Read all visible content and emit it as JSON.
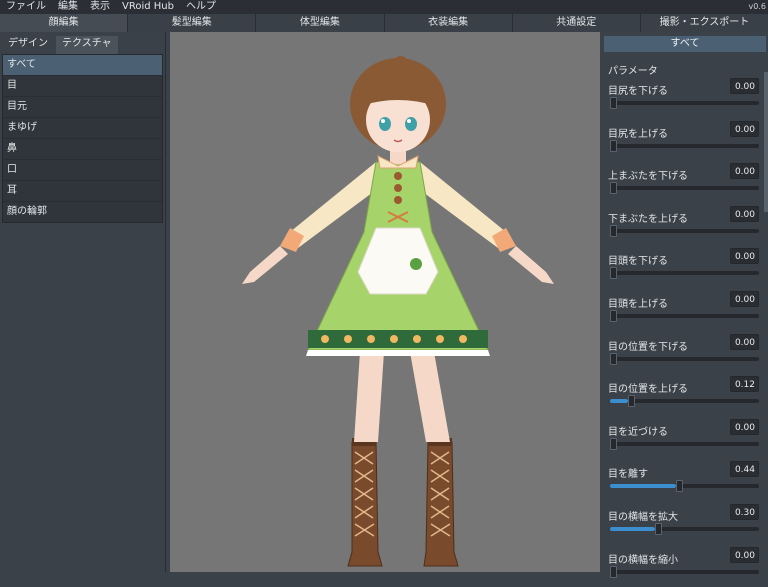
{
  "menubar": {
    "items": [
      "ファイル",
      "編集",
      "表示",
      "VRoid Hub",
      "ヘルプ"
    ],
    "version": "v0.6"
  },
  "toptabs": [
    "顔編集",
    "髪型編集",
    "体型編集",
    "衣装編集",
    "共通設定",
    "撮影・エクスポート"
  ],
  "left": {
    "subtabs": [
      "デザイン",
      "テクスチャ"
    ],
    "categories": [
      "すべて",
      "目",
      "目元",
      "まゆげ",
      "鼻",
      "口",
      "耳",
      "顔の輪郭"
    ]
  },
  "right": {
    "header": "すべて",
    "section": "パラメータ",
    "params": [
      {
        "label": "目尻を下げる",
        "value": "0.00",
        "level": 0.0
      },
      {
        "label": "目尻を上げる",
        "value": "0.00",
        "level": 0.0
      },
      {
        "label": "上まぶたを下げる",
        "value": "0.00",
        "level": 0.0
      },
      {
        "label": "下まぶたを上げる",
        "value": "0.00",
        "level": 0.0
      },
      {
        "label": "目頭を下げる",
        "value": "0.00",
        "level": 0.0
      },
      {
        "label": "目頭を上げる",
        "value": "0.00",
        "level": 0.0
      },
      {
        "label": "目の位置を下げる",
        "value": "0.00",
        "level": 0.0
      },
      {
        "label": "目の位置を上げる",
        "value": "0.12",
        "level": 0.12
      },
      {
        "label": "目を近づける",
        "value": "0.00",
        "level": 0.0
      },
      {
        "label": "目を離す",
        "value": "0.44",
        "level": 0.44
      },
      {
        "label": "目の横幅を拡大",
        "value": "0.30",
        "level": 0.3
      },
      {
        "label": "目の横幅を縮小",
        "value": "0.00",
        "level": 0.0
      }
    ]
  },
  "colors": {
    "accent": "#4b6173",
    "slider_fill": "#3c8fcf",
    "viewport_bg": "#767676",
    "dress_green": "#a6d46b",
    "hair_brown": "#8a5a35"
  }
}
